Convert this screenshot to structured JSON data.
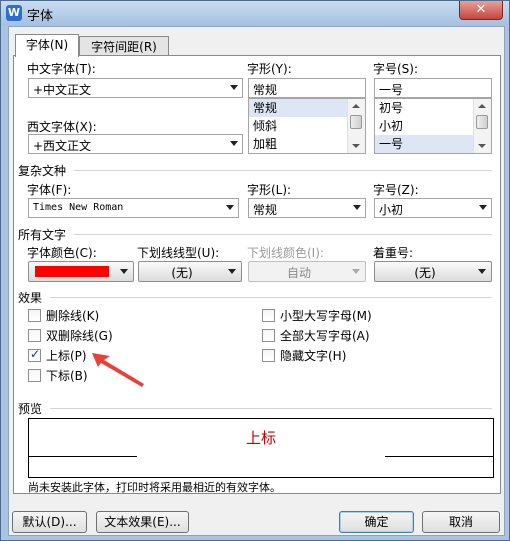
{
  "window": {
    "title": "字体",
    "app_icon": "W",
    "close_label": "✕"
  },
  "tabs": [
    {
      "label": "字体(N)"
    },
    {
      "label": "字符间距(R)"
    }
  ],
  "chinese_font": {
    "label": "中文字体(T):",
    "value": "+中文正文"
  },
  "style": {
    "label": "字形(Y):",
    "value": "常规",
    "options": [
      "常规",
      "倾斜",
      "加粗"
    ]
  },
  "size": {
    "label": "字号(S):",
    "value": "一号",
    "options": [
      "初号",
      "小初",
      "一号"
    ]
  },
  "western_font": {
    "label": "西文字体(X):",
    "value": "+西文正文"
  },
  "complex": {
    "section": "复杂文种",
    "font_label": "字体(F):",
    "font_value": "Times New Roman",
    "style_label": "字形(L):",
    "style_value": "常规",
    "size_label": "字号(Z):",
    "size_value": "小初"
  },
  "all_text": {
    "section": "所有文字",
    "color_label": "字体颜色(C):",
    "font_color": "#ff0000",
    "underline_label": "下划线线型(U):",
    "underline_value": "(无)",
    "underline_color_label": "下划线颜色(I):",
    "underline_color_value": "自动",
    "emphasis_label": "着重号:",
    "emphasis_value": "(无)"
  },
  "effects": {
    "section": "效果",
    "strikethrough": {
      "label": "删除线(K)",
      "checked": false
    },
    "double_strikethrough": {
      "label": "双删除线(G)",
      "checked": false
    },
    "superscript": {
      "label": "上标(P)",
      "checked": true
    },
    "subscript": {
      "label": "下标(B)",
      "checked": false
    },
    "small_caps": {
      "label": "小型大写字母(M)",
      "checked": false
    },
    "all_caps": {
      "label": "全部大写字母(A)",
      "checked": false
    },
    "hidden": {
      "label": "隐藏文字(H)",
      "checked": false
    }
  },
  "preview": {
    "section": "预览",
    "sample": "上标",
    "sample_color": "#c00000"
  },
  "note": "尚未安装此字体，打印时将采用最相近的有效字体。",
  "buttons": {
    "default": "默认(D)...",
    "text_effect": "文本效果(E)...",
    "ok": "确定",
    "cancel": "取消"
  },
  "annotation_color": "#e8403a"
}
